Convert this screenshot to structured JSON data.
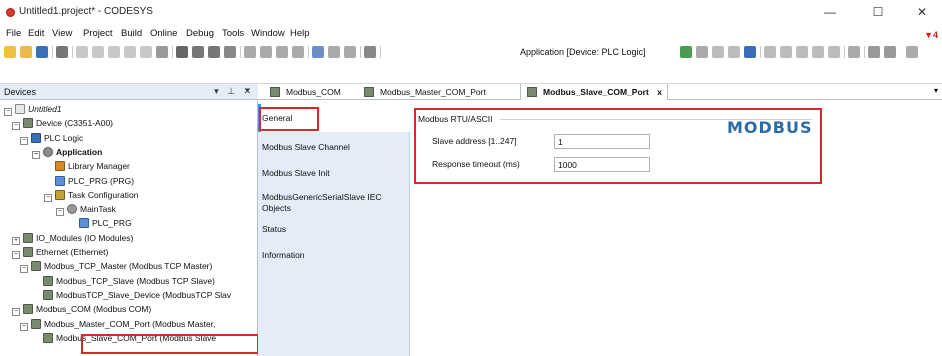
{
  "window": {
    "title": "Untitled1.project* - CODESYS",
    "minimize": "—",
    "maximize": "☐",
    "close": "✕"
  },
  "menu": [
    "File",
    "Edit",
    "View",
    "Project",
    "Build",
    "Online",
    "Debug",
    "Tools",
    "Window",
    "Help"
  ],
  "notification": "▼4",
  "toolbar": {
    "application_label": "Application [Device: PLC Logic]"
  },
  "devices_pane": {
    "title": "Devices",
    "controls": "▾ ⊥ ✕",
    "tree": [
      {
        "label": "Untitled1",
        "exp": "−",
        "icon": "ic-untitled",
        "style": "italic"
      },
      {
        "label": "Device (C3351-A00)",
        "exp": "−",
        "icon": "ic-dev",
        "style": ""
      },
      {
        "label": "PLC Logic",
        "exp": "−",
        "icon": "ic-plc",
        "style": ""
      },
      {
        "label": "Application",
        "exp": "−",
        "icon": "ic-gear",
        "style": "bold"
      },
      {
        "label": "Library Manager",
        "exp": "",
        "icon": "ic-lib",
        "style": ""
      },
      {
        "label": "PLC_PRG (PRG)",
        "exp": "",
        "icon": "ic-prg",
        "style": ""
      },
      {
        "label": "Task Configuration",
        "exp": "−",
        "icon": "ic-task",
        "style": ""
      },
      {
        "label": "MainTask",
        "exp": "−",
        "icon": "ic-main",
        "style": ""
      },
      {
        "label": "PLC_PRG",
        "exp": "",
        "icon": "ic-prg",
        "style": ""
      },
      {
        "label": "IO_Modules (IO Modules)",
        "exp": "+",
        "icon": "ic-dev",
        "style": ""
      },
      {
        "label": "Ethernet (Ethernet)",
        "exp": "−",
        "icon": "ic-dev",
        "style": ""
      },
      {
        "label": "Modbus_TCP_Master (Modbus TCP Master)",
        "exp": "−",
        "icon": "ic-dev",
        "style": ""
      },
      {
        "label": "Modbus_TCP_Slave (Modbus TCP Slave)",
        "exp": "",
        "icon": "ic-dev",
        "style": ""
      },
      {
        "label": "ModbusTCP_Slave_Device (ModbusTCP Slav",
        "exp": "",
        "icon": "ic-dev",
        "style": ""
      },
      {
        "label": "Modbus_COM (Modbus COM)",
        "exp": "−",
        "icon": "ic-dev",
        "style": ""
      },
      {
        "label": "Modbus_Master_COM_Port (Modbus Master,",
        "exp": "−",
        "icon": "ic-dev",
        "style": ""
      },
      {
        "label": "Modbus_Slave_COM_Port (Modbus Slave",
        "exp": "",
        "icon": "ic-dev",
        "style": ""
      }
    ]
  },
  "tabs": [
    {
      "label": "Modbus_COM"
    },
    {
      "label": "Modbus_Master_COM_Port"
    },
    {
      "label": "Modbus_Slave_COM_Port",
      "close": "x"
    }
  ],
  "sidenav": [
    "General",
    "Modbus Slave Channel",
    "Modbus Slave Init",
    "ModbusGenericSerialSlave IEC Objects",
    "Status",
    "Information"
  ],
  "content": {
    "group_title": "Modbus RTU/ASCII",
    "logo_text": "MODBUS",
    "fields": [
      {
        "label": "Slave address [1..247]",
        "value": "1"
      },
      {
        "label": "Response timeout (ms)",
        "value": "1000"
      }
    ]
  },
  "colors": {
    "highlight": "#d62a2a",
    "nav_bg": "#e4ecf7",
    "logo": "#2d6ba8"
  }
}
